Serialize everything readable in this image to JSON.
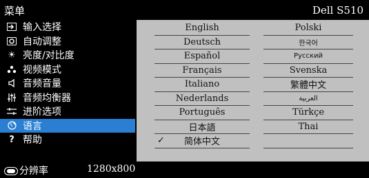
{
  "header": {
    "title": "菜单",
    "model": "Dell S510"
  },
  "menu": [
    {
      "label": "输入选择",
      "icon": "input-icon"
    },
    {
      "label": "自动调整",
      "icon": "auto-adjust-icon"
    },
    {
      "label": "亮度/对比度",
      "icon": "brightness-icon"
    },
    {
      "label": "视频模式",
      "icon": "video-mode-icon"
    },
    {
      "label": "音频音量",
      "icon": "speaker-icon"
    },
    {
      "label": "音频均衡器",
      "icon": "equalizer-icon"
    },
    {
      "label": "进阶选项",
      "icon": "advanced-icon"
    },
    {
      "label": "语言",
      "icon": "globe-icon",
      "selected": true
    },
    {
      "label": "帮助",
      "icon": "help-icon"
    }
  ],
  "languages": {
    "left": [
      "English",
      "Deutsch",
      "Español",
      "Français",
      "Italiano",
      "Nederlands",
      "Português",
      "日本語",
      "简体中文"
    ],
    "right": [
      "Polski",
      "한국어",
      "Русский",
      "Svenska",
      "繁體中文",
      "العربية",
      "Türkçe",
      "Thai"
    ],
    "selected": "简体中文"
  },
  "footer": {
    "resolution_label": "分辨率",
    "resolution_value": "1280x800"
  },
  "colors": {
    "selection": "#2a7fd3",
    "panel": "#c0c0c0"
  }
}
